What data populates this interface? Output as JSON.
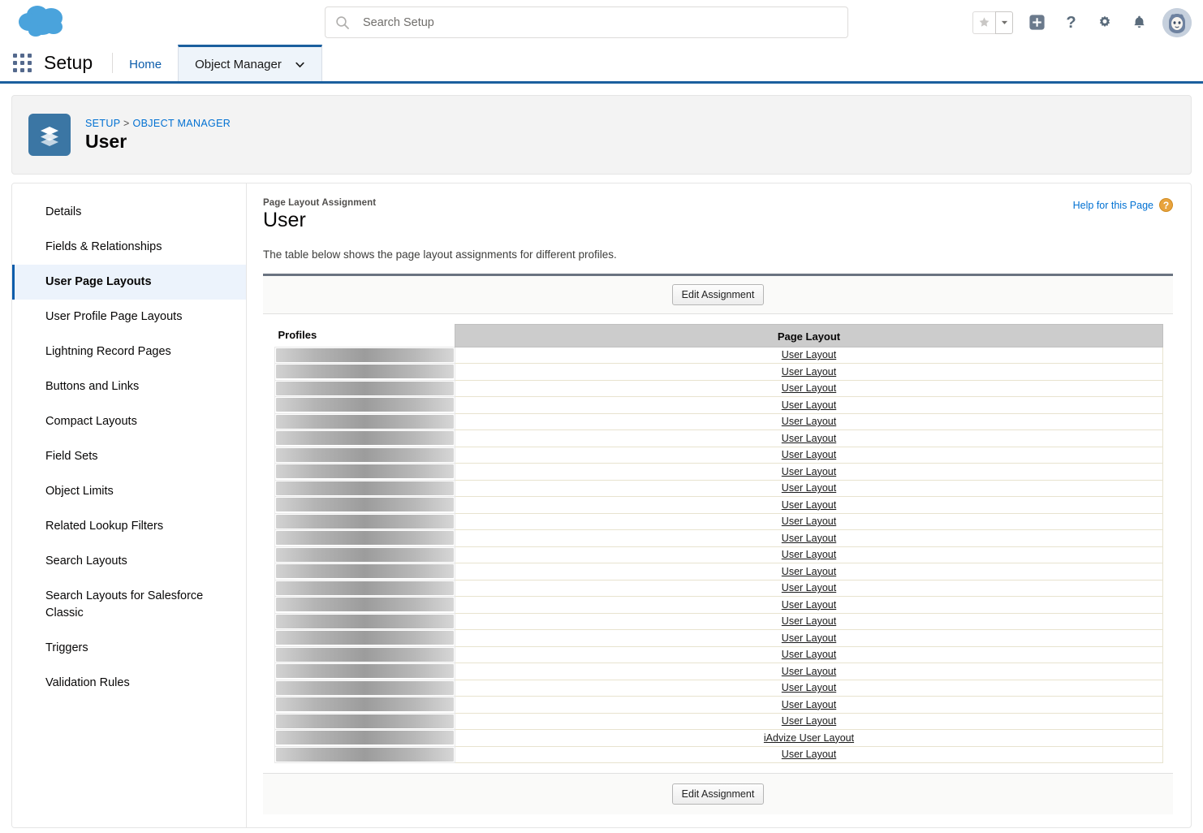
{
  "header": {
    "logo_name": "salesforce-cloud-logo",
    "search": {
      "placeholder": "Search Setup",
      "value": ""
    },
    "actions": {
      "favorite_label": "Favorite",
      "favorite_dropdown_label": "Favorites list",
      "global_create_label": "Global Actions",
      "help_label": "Help",
      "setup_label": "Setup",
      "notifications_label": "Notifications",
      "avatar_label": "User profile"
    }
  },
  "setup_nav": {
    "app_launcher_label": "App Launcher",
    "title": "Setup",
    "tabs": [
      {
        "label": "Home",
        "active": false,
        "has_caret": false
      },
      {
        "label": "Object Manager",
        "active": true,
        "has_caret": true
      }
    ]
  },
  "record_header": {
    "breadcrumb": {
      "root": "SETUP",
      "separator": ">",
      "parent": "OBJECT MANAGER"
    },
    "title": "User",
    "icon_name": "object-layers-icon"
  },
  "sidebar": {
    "items": [
      {
        "label": "Details",
        "active": false
      },
      {
        "label": "Fields & Relationships",
        "active": false
      },
      {
        "label": "User Page Layouts",
        "active": true
      },
      {
        "label": "User Profile Page Layouts",
        "active": false
      },
      {
        "label": "Lightning Record Pages",
        "active": false
      },
      {
        "label": "Buttons and Links",
        "active": false
      },
      {
        "label": "Compact Layouts",
        "active": false
      },
      {
        "label": "Field Sets",
        "active": false
      },
      {
        "label": "Object Limits",
        "active": false
      },
      {
        "label": "Related Lookup Filters",
        "active": false
      },
      {
        "label": "Search Layouts",
        "active": false
      },
      {
        "label": "Search Layouts for Salesforce Classic",
        "active": false
      },
      {
        "label": "Triggers",
        "active": false
      },
      {
        "label": "Validation Rules",
        "active": false
      }
    ]
  },
  "main": {
    "eyebrow": "Page Layout Assignment",
    "title": "User",
    "description": "The table below shows the page layout assignments for different profiles.",
    "help_link": {
      "label": "Help for this Page",
      "badge": "?"
    },
    "edit_button_top": "Edit Assignment",
    "edit_button_bottom": "Edit Assignment",
    "table": {
      "columns": [
        "Profiles",
        "Page Layout"
      ],
      "rows": [
        {
          "profile": "",
          "profile_redacted": true,
          "layout": "User Layout"
        },
        {
          "profile": "",
          "profile_redacted": true,
          "layout": "User Layout"
        },
        {
          "profile": "",
          "profile_redacted": true,
          "layout": "User Layout"
        },
        {
          "profile": "",
          "profile_redacted": true,
          "layout": "User Layout"
        },
        {
          "profile": "",
          "profile_redacted": true,
          "layout": "User Layout"
        },
        {
          "profile": "",
          "profile_redacted": true,
          "layout": "User Layout"
        },
        {
          "profile": "",
          "profile_redacted": true,
          "layout": "User Layout"
        },
        {
          "profile": "",
          "profile_redacted": true,
          "layout": "User Layout"
        },
        {
          "profile": "",
          "profile_redacted": true,
          "layout": "User Layout"
        },
        {
          "profile": "",
          "profile_redacted": true,
          "layout": "User Layout"
        },
        {
          "profile": "",
          "profile_redacted": true,
          "layout": "User Layout"
        },
        {
          "profile": "",
          "profile_redacted": true,
          "layout": "User Layout"
        },
        {
          "profile": "",
          "profile_redacted": true,
          "layout": "User Layout"
        },
        {
          "profile": "",
          "profile_redacted": true,
          "layout": "User Layout"
        },
        {
          "profile": "",
          "profile_redacted": true,
          "layout": "User Layout"
        },
        {
          "profile": "",
          "profile_redacted": true,
          "layout": "User Layout"
        },
        {
          "profile": "",
          "profile_redacted": true,
          "layout": "User Layout"
        },
        {
          "profile": "",
          "profile_redacted": true,
          "layout": "User Layout"
        },
        {
          "profile": "",
          "profile_redacted": true,
          "layout": "User Layout"
        },
        {
          "profile": "",
          "profile_redacted": true,
          "layout": "User Layout"
        },
        {
          "profile": "",
          "profile_redacted": true,
          "layout": "User Layout"
        },
        {
          "profile": "",
          "profile_redacted": true,
          "layout": "User Layout"
        },
        {
          "profile": "",
          "profile_redacted": true,
          "layout": "User Layout"
        },
        {
          "profile": "",
          "profile_redacted": true,
          "layout": "iAdvize User Layout"
        },
        {
          "profile": "",
          "profile_redacted": true,
          "layout": "User Layout"
        }
      ]
    }
  },
  "colors": {
    "brand_blue": "#0070d2",
    "nav_active_blue": "#1b5f9e",
    "object_icon_blue": "#3b76a4",
    "help_badge_orange": "#e8a33d",
    "panel_top_border": "#6a7381",
    "table_header_gray": "#cccccc"
  }
}
